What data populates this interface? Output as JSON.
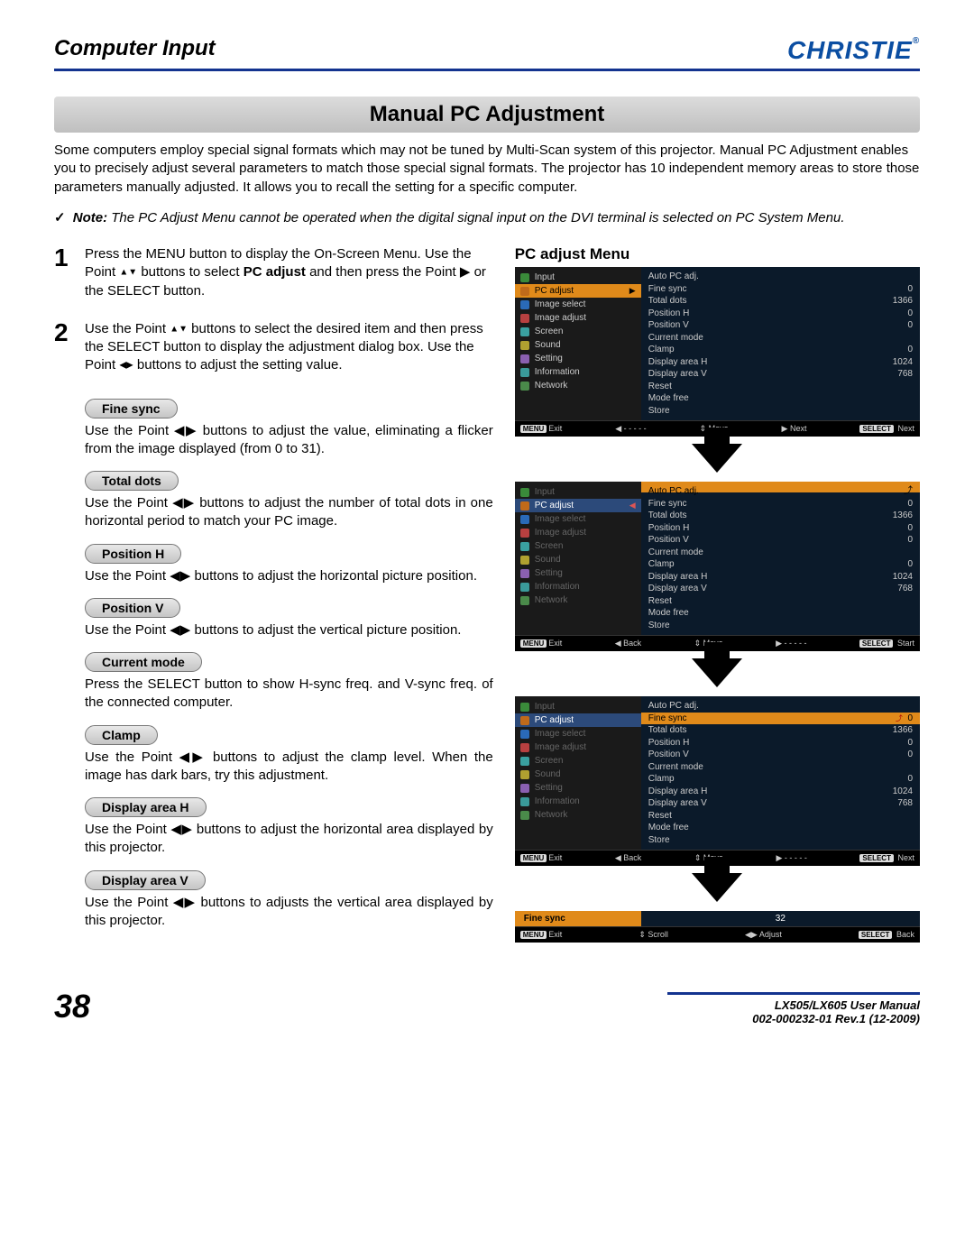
{
  "header": {
    "section": "Computer Input",
    "logo": "CHRISTIE"
  },
  "title": "Manual PC Adjustment",
  "intro": "Some computers employ special signal formats which may not be tuned by Multi-Scan system of this projector. Manual PC Adjustment enables you to precisely adjust several parameters to match those special signal formats. The projector has 10 independent memory areas to store those parameters manually adjusted. It allows you to recall the setting for a specific computer.",
  "note": {
    "label": "Note:",
    "text": "The PC Adjust Menu cannot be operated when the digital signal input on the DVI terminal is selected on PC System Menu."
  },
  "steps": [
    {
      "n": "1",
      "text_a": "Press the MENU button to display the On-Screen Menu. Use the Point ",
      "text_b": " buttons to select ",
      "bold": "PC adjust",
      "text_c": " and then press the Point ▶ or the SELECT button."
    },
    {
      "n": "2",
      "text_a": "Use the Point ",
      "text_b": " buttons to select the desired item and then press the SELECT button to display the adjustment dialog box. Use the Point ",
      "text_c": " buttons to adjust the setting value."
    }
  ],
  "params": [
    {
      "name": "Fine sync",
      "text": "Use the Point ◀▶ buttons to adjust the value, eliminating a flicker from the image displayed (from 0 to 31)."
    },
    {
      "name": "Total dots",
      "text": "Use the Point ◀▶ buttons to adjust the number of total dots in one horizontal period to match your PC image."
    },
    {
      "name": "Position H",
      "text": "Use the Point ◀▶ buttons to adjust the horizontal picture position."
    },
    {
      "name": "Position V",
      "text": "Use the Point ◀▶ buttons to adjust the vertical picture position."
    },
    {
      "name": "Current mode",
      "text": "Press the SELECT button to show H-sync freq. and V-sync freq. of the connected computer."
    },
    {
      "name": "Clamp",
      "text": "Use the Point ◀▶ buttons to adjust the clamp level. When the image has dark bars, try this adjustment."
    },
    {
      "name": "Display area H",
      "text": "Use the Point ◀▶ buttons to adjust the horizontal area displayed by this projector."
    },
    {
      "name": "Display area V",
      "text": "Use the Point ◀▶ buttons to adjusts the vertical area displayed by this projector."
    }
  ],
  "right_heading": "PC adjust Menu",
  "menu_items": [
    "Input",
    "PC adjust",
    "Image select",
    "Image adjust",
    "Screen",
    "Sound",
    "Setting",
    "Information",
    "Network"
  ],
  "panel_rows": [
    {
      "l": "Auto PC adj.",
      "v": ""
    },
    {
      "l": "Fine sync",
      "v": "0"
    },
    {
      "l": "Total dots",
      "v": "1366"
    },
    {
      "l": "Position H",
      "v": "0"
    },
    {
      "l": "Position V",
      "v": "0"
    },
    {
      "l": "Current mode",
      "v": ""
    },
    {
      "l": "Clamp",
      "v": "0"
    },
    {
      "l": "Display area H",
      "v": "1024"
    },
    {
      "l": "Display area V",
      "v": "768"
    },
    {
      "l": "Reset",
      "v": ""
    },
    {
      "l": "Mode free",
      "v": ""
    },
    {
      "l": "Store",
      "v": ""
    }
  ],
  "foot1": {
    "a": "Exit",
    "b": "- - - - -",
    "c": "Move",
    "d": "Next",
    "e": "Next"
  },
  "foot2": {
    "a": "Exit",
    "b": "Back",
    "c": "Move",
    "d": "- - - - -",
    "e": "Start"
  },
  "foot3": {
    "a": "Exit",
    "b": "Back",
    "c": "Move",
    "d": "- - - - -",
    "e": "Next"
  },
  "mini": {
    "label": "Fine sync",
    "value": "32"
  },
  "mini_foot": {
    "a": "Exit",
    "b": "Scroll",
    "c": "Adjust",
    "d": "Back"
  },
  "footer": {
    "page": "38",
    "line1": "LX505/LX605 User Manual",
    "line2": "002-000232-01 Rev.1 (12-2009)"
  }
}
